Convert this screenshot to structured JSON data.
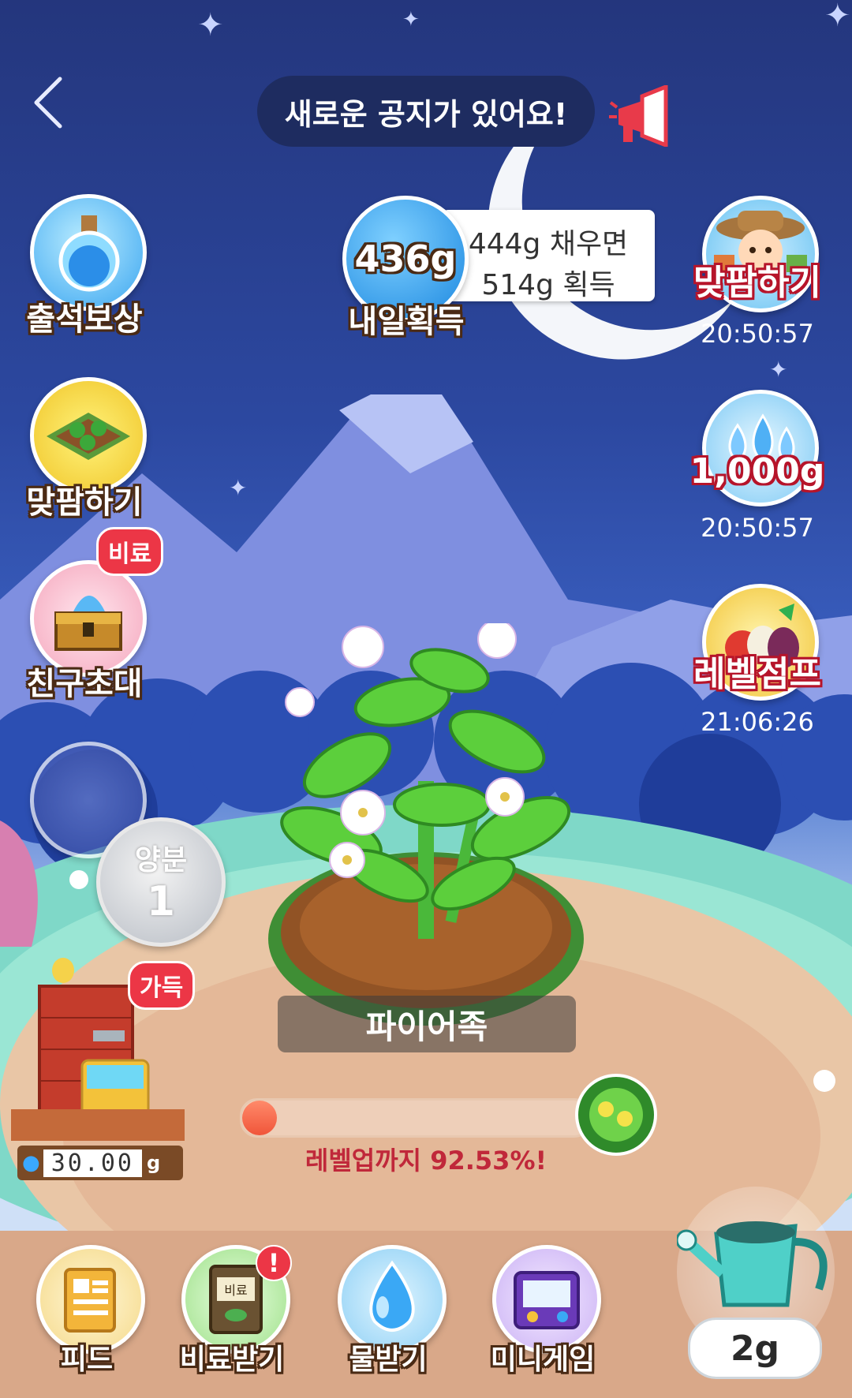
{
  "header": {
    "back_icon": "chevron-left-icon",
    "banner_text": "새로운 공지가 있어요!",
    "megaphone_icon": "megaphone-icon"
  },
  "harvest": {
    "amount": "436g",
    "label": "내일획득",
    "tip_line1": "444g 채우면",
    "tip_line2": "514g 획득"
  },
  "left_menu": [
    {
      "label": "출석보상",
      "icon": "potion-bottle-icon"
    },
    {
      "label": "맞팜하기",
      "icon": "farm-plot-icon"
    },
    {
      "label": "친구초대",
      "icon": "treasure-chest-icon",
      "badge": "비료"
    }
  ],
  "right_menu": [
    {
      "label": "맞팜하기",
      "timer": "20:50:57",
      "icon": "farmer-icon"
    },
    {
      "label": "1,000g",
      "timer": "20:50:57",
      "icon": "water-drops-icon"
    },
    {
      "label": "레벨점프",
      "timer": "21:06:26",
      "icon": "vegetables-icon"
    }
  ],
  "nutrient": {
    "label": "양분",
    "value": "1"
  },
  "water_tank": {
    "badge": "가득",
    "value": "30.00",
    "unit": "g"
  },
  "plant": {
    "name": "파이어족"
  },
  "progress": {
    "text": "레벨업까지 92.53%!",
    "fraction": 0.9253
  },
  "bottom_nav": [
    {
      "label": "피드",
      "icon": "feed-icon"
    },
    {
      "label": "비료받기",
      "icon": "fertilizer-bag-icon",
      "bag_text": "비료"
    },
    {
      "label": "물받기",
      "icon": "water-drop-icon"
    },
    {
      "label": "미니게임",
      "icon": "game-console-icon"
    }
  ],
  "watering": {
    "amount": "2g",
    "icon": "watering-can-icon"
  },
  "colors": {
    "sky": "#2c48a0",
    "accent_red": "#ec3646",
    "label_brown": "#4a2a14",
    "progress_text": "#c0283a"
  }
}
